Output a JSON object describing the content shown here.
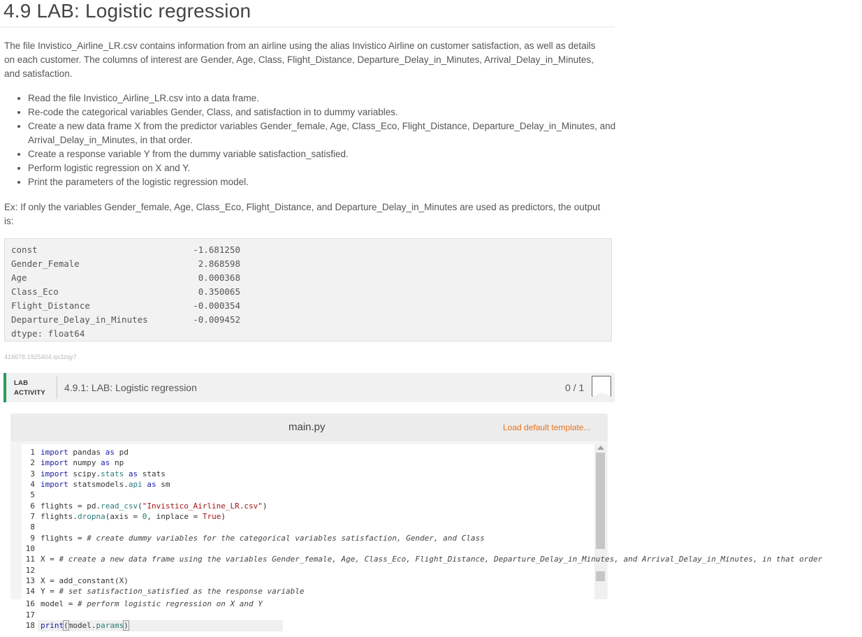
{
  "page": {
    "title": "4.9 LAB: Logistic regression",
    "intro": "The file Invistico_Airline_LR.csv contains information from an airline using the alias Invistico Airline on customer satisfaction, as well as details on each customer. The columns of interest are Gender, Age, Class, Flight_Distance, Departure_Delay_in_Minutes, Arrival_Delay_in_Minutes, and satisfaction.",
    "bullets": [
      "Read the file Invistico_Airline_LR.csv into a data frame.",
      "Re-code the categorical variables Gender, Class, and satisfaction in to dummy variables.",
      "Create a new data frame X from the predictor variables Gender_female, Age, Class_Eco, Flight_Distance, Departure_Delay_in_Minutes, and Arrival_Delay_in_Minutes, in that order.",
      "Create a response variable Y from the dummy variable satisfaction_satisfied.",
      "Perform logistic regression on X and Y.",
      "Print the parameters of the logistic regression model."
    ],
    "example": "Ex: If only the variables Gender_female, Age, Class_Eco, Flight_Distance, and Departure_Delay_in_Minutes are used as predictors, the output is:",
    "output_rows": [
      {
        "name": "const",
        "value": "-1.681250"
      },
      {
        "name": "Gender_Female",
        "value": "2.868598"
      },
      {
        "name": "Age",
        "value": "0.000368"
      },
      {
        "name": "Class_Eco",
        "value": "0.350065"
      },
      {
        "name": "Flight_Distance",
        "value": "-0.000354"
      },
      {
        "name": "Departure_Delay_in_Minutes",
        "value": "-0.009452"
      }
    ],
    "dtype": "dtype: float64",
    "caption_id": "416678.1925404.qx3zqy7"
  },
  "lab": {
    "tag_line1": "LAB",
    "tag_line2": "ACTIVITY",
    "title": "4.9.1: LAB: Logistic regression",
    "score": "0 / 1"
  },
  "editor": {
    "file_name": "main.py",
    "load_label": "Load default template..."
  }
}
